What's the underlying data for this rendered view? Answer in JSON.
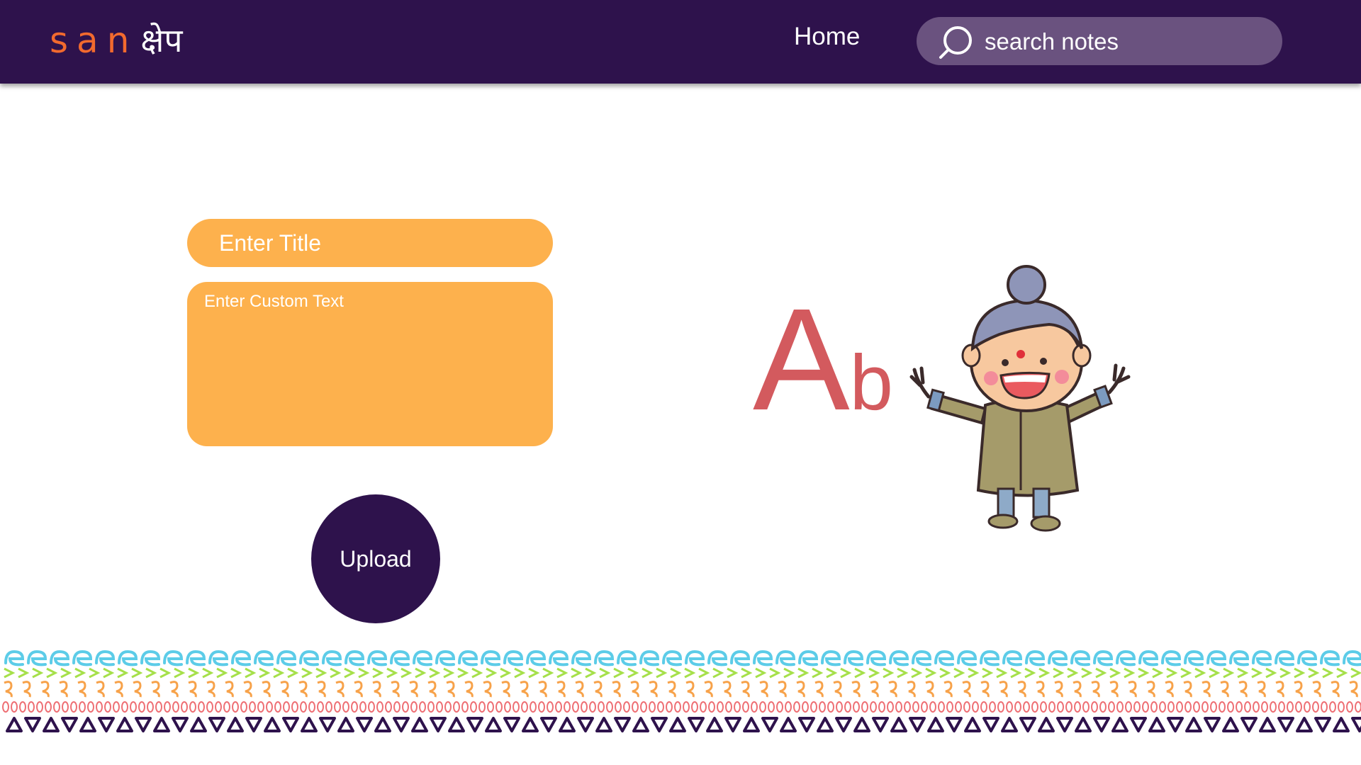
{
  "header": {
    "logo_latin": "san",
    "logo_devanagari": "क्षेप",
    "nav_home": "Home",
    "search_placeholder": "search notes"
  },
  "form": {
    "title_placeholder": "Enter Title",
    "text_placeholder": "Enter Custom Text",
    "upload_label": "Upload"
  },
  "illustration": {
    "big_letter": "A",
    "small_letter": "b"
  },
  "colors": {
    "navbar": "#2e124c",
    "search_bg": "#6a527f",
    "input_bg": "#fdb14d",
    "logo_accent": "#f26a2e",
    "ab_letters": "#d35a5e",
    "border_row_1": "#5ccce8",
    "border_row_2": "#a6e04a",
    "border_row_3": "#f7a24a",
    "border_row_4": "#ee6f74",
    "border_row_5": "#2e124c"
  },
  "icons": [
    "search-icon",
    "grandma-mascot-illustration",
    "decorative-pattern-border"
  ]
}
